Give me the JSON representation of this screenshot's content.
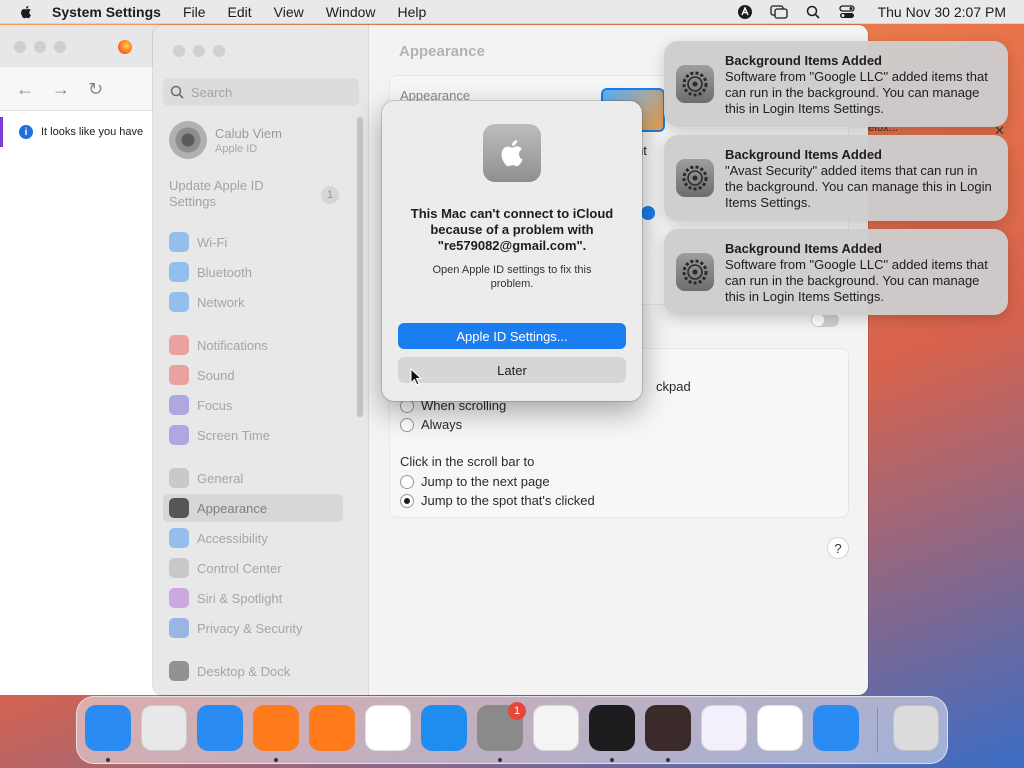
{
  "menubar": {
    "app_name": "System Settings",
    "menus": [
      "File",
      "Edit",
      "View",
      "Window",
      "Help"
    ],
    "clock": "Thu Nov 30  2:07 PM"
  },
  "browser": {
    "notice_text": "It looks like you have"
  },
  "settings": {
    "search_placeholder": "Search",
    "account_name": "Calub Viem",
    "account_sub": "Apple ID",
    "update_text": "Update Apple ID Settings",
    "update_badge": "1",
    "sidebar_items": [
      {
        "label": "Wi-Fi",
        "icon": "wifi-icon",
        "color": "#2f8cf0"
      },
      {
        "label": "Bluetooth",
        "icon": "bluetooth-icon",
        "color": "#2f8cf0"
      },
      {
        "label": "Network",
        "icon": "network-icon",
        "color": "#2f8cf0"
      },
      {
        "label": "Notifications",
        "icon": "notifications-icon",
        "color": "#ea4d43"
      },
      {
        "label": "Sound",
        "icon": "sound-icon",
        "color": "#ea4d43"
      },
      {
        "label": "Focus",
        "icon": "focus-icon",
        "color": "#6b5bd8"
      },
      {
        "label": "Screen Time",
        "icon": "screen-time-icon",
        "color": "#6b5bd8"
      },
      {
        "label": "General",
        "icon": "general-icon",
        "color": "#a3a3a3"
      },
      {
        "label": "Appearance",
        "icon": "appearance-icon",
        "color": "#2b2b2b"
      },
      {
        "label": "Accessibility",
        "icon": "accessibility-icon",
        "color": "#2f8cf0"
      },
      {
        "label": "Control Center",
        "icon": "control-center-icon",
        "color": "#a3a3a3"
      },
      {
        "label": "Siri & Spotlight",
        "icon": "siri-icon",
        "color": "#b05ad8"
      },
      {
        "label": "Privacy & Security",
        "icon": "privacy-icon",
        "color": "#3a78e0"
      },
      {
        "label": "Desktop & Dock",
        "icon": "desktop-dock-icon",
        "color": "#2b2b2b"
      }
    ],
    "active_item": "Appearance",
    "page_title": "Appearance",
    "appearance_label": "Appearance",
    "frag_accent": "nt",
    "frag_r": "r",
    "frag_trackpad": "ckpad",
    "scroll_options": [
      "When scrolling",
      "Always"
    ],
    "click_label": "Click in the scroll bar to",
    "click_options": [
      "Jump to the next page",
      "Jump to the spot that's clicked"
    ],
    "selected_click": 1,
    "help": "?"
  },
  "dialog": {
    "title": "This Mac can't connect to iCloud because of a problem with \"re579082@gmail.com\".",
    "message": "Open Apple ID settings to fix this problem.",
    "primary": "Apple ID Settings...",
    "secondary": "Later"
  },
  "notifications": [
    {
      "title": "Background Items Added",
      "body": "Software from \"Google LLC\" added items that can run in the background. You can manage this in Login Items Settings."
    },
    {
      "title": "Background Items Added",
      "body": "\"Avast Security\" added items that can run in the background. You can manage this in Login Items Settings."
    },
    {
      "title": "Background Items Added",
      "body": "Software from \"Google LLC\" added items that can run in the background. You can manage this in Login Items Settings."
    }
  ],
  "notif_frag": "efox...",
  "dock": {
    "apps": [
      {
        "name": "finder-icon",
        "color": "#2a8bf2"
      },
      {
        "name": "launchpad-icon",
        "color": "#e8e8ea"
      },
      {
        "name": "safari-icon",
        "color": "#2a8bf2"
      },
      {
        "name": "firefox-icon",
        "color": "#ff7a1a"
      },
      {
        "name": "avast-icon",
        "color": "#ff7a1a"
      },
      {
        "name": "chrome-icon",
        "color": "#ffffff"
      },
      {
        "name": "app-store-icon",
        "color": "#1f8cf0"
      },
      {
        "name": "system-settings-icon",
        "color": "#8a8a8a"
      },
      {
        "name": "textedit-icon",
        "color": "#f4f4f4"
      },
      {
        "name": "terminal-icon",
        "color": "#1d1d1f"
      },
      {
        "name": "instruments-icon",
        "color": "#3a2a2a"
      },
      {
        "name": "visual-studio-icon",
        "color": "#f4f0fb"
      },
      {
        "name": "vscode-icon",
        "color": "#ffffff"
      },
      {
        "name": "weather-icon",
        "color": "#2a8bf2"
      },
      {
        "name": "trash-icon",
        "color": "#dcdcdc"
      }
    ],
    "settings_badge": "1"
  }
}
